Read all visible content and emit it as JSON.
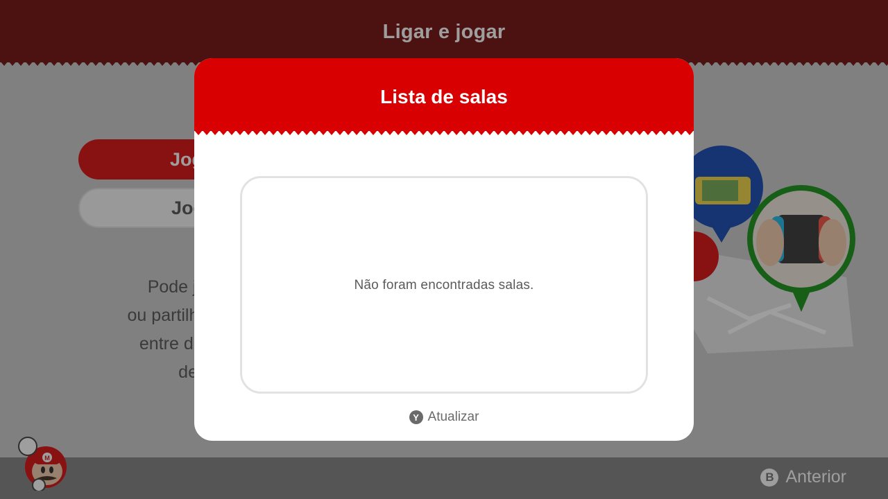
{
  "screen": {
    "title": "Ligar e jogar",
    "menu": {
      "primary_label": "Jogar online",
      "secondary_label": "Jogar localmente"
    },
    "description_lines": [
      "Pode jogar online",
      "ou partilhar localmente",
      "entre duas pessoas",
      "de quatro"
    ],
    "bottom": {
      "back_button_glyph": "B",
      "back_label": "Anterior"
    }
  },
  "modal": {
    "title": "Lista de salas",
    "empty_message": "Não foram encontradas salas.",
    "refresh_button_glyph": "Y",
    "refresh_label": "Atualizar"
  },
  "colors": {
    "accent_red": "#d80000",
    "top_bar_red": "#6b0000",
    "bottom_bar": "#7a7a7a"
  },
  "icons": [
    "mario-mascot-icon",
    "y-button-icon",
    "b-button-icon"
  ]
}
